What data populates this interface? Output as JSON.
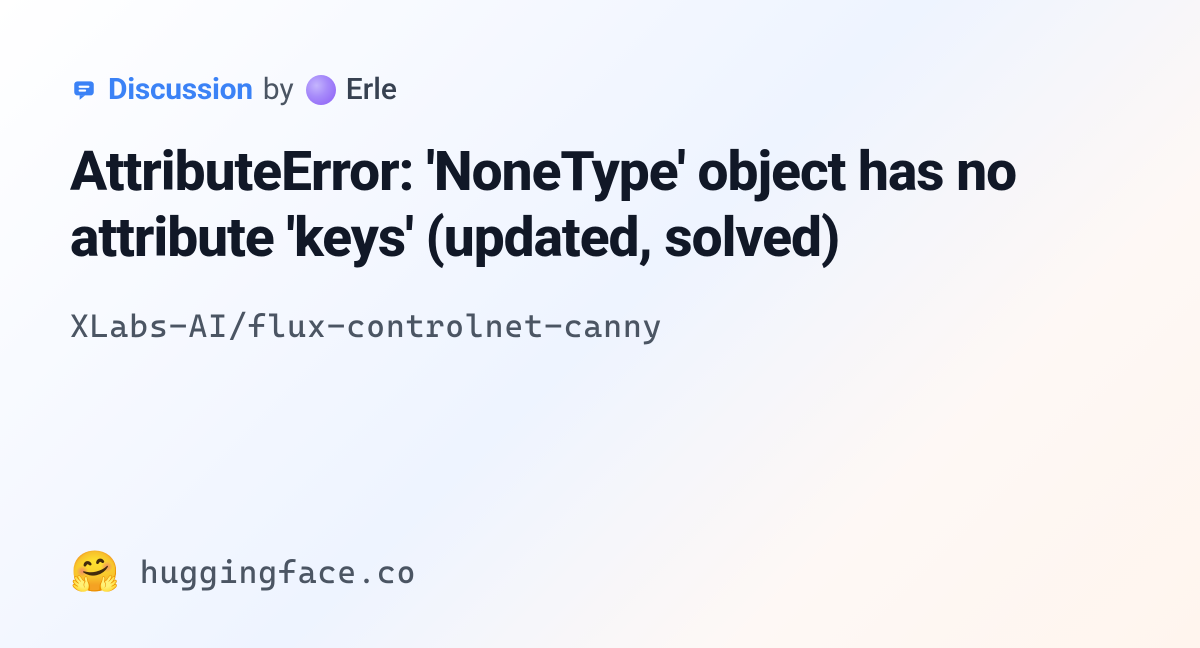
{
  "meta": {
    "discussion_label": "Discussion",
    "by_text": "by",
    "author": "Erle"
  },
  "title": "AttributeError: 'NoneType' object has no attribute 'keys' (updated, solved)",
  "repo": "XLabs-AI/flux-controlnet-canny",
  "footer": {
    "emoji": "🤗",
    "site": "huggingface.co"
  },
  "colors": {
    "accent": "#3b82f6",
    "text_primary": "#111827",
    "text_secondary": "#4b5563"
  }
}
